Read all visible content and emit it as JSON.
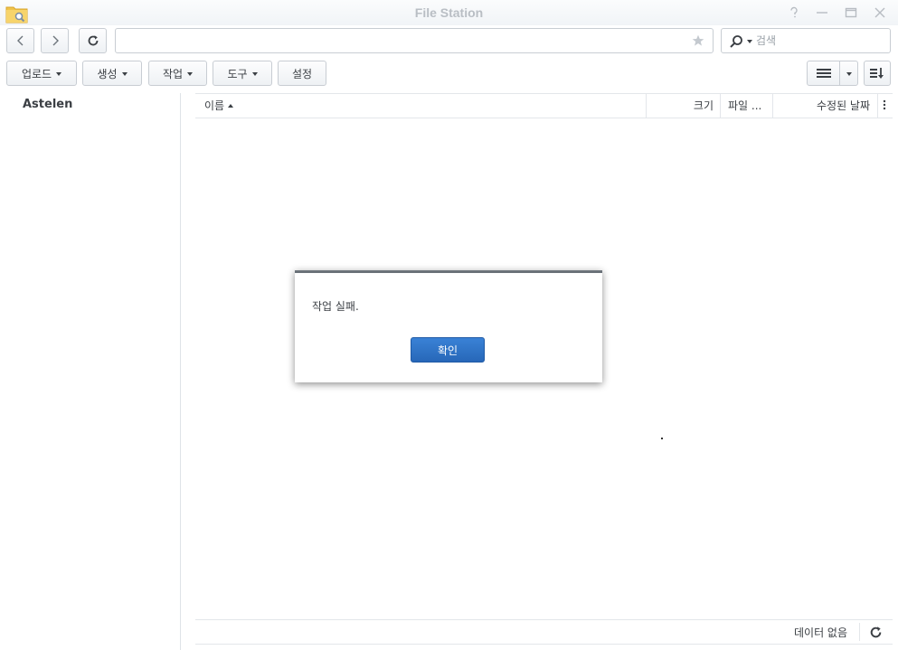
{
  "window": {
    "title": "File Station",
    "icons": [
      "folder-search-icon",
      "help-icon",
      "minimize-icon",
      "maximize-icon",
      "close-icon"
    ]
  },
  "toolbar": {
    "path_value": "",
    "search_placeholder": "검색",
    "menus": [
      "업로드",
      "생성",
      "작업",
      "도구"
    ],
    "settings_label": "설정"
  },
  "sidebar": {
    "root": "Astelen"
  },
  "file_list": {
    "columns": {
      "name": "이름",
      "size": "크기",
      "type": "파일 ...",
      "modified": "수정된 날짜"
    },
    "sort": {
      "column": "name",
      "direction": "ascending"
    },
    "rows": []
  },
  "status": {
    "text": "데이터 없음"
  },
  "dialog": {
    "message": "작업 실패.",
    "ok_label": "확인"
  },
  "colors": {
    "accent": "#2767b8",
    "text": "#3b3f44",
    "border": "#c8cdd3"
  }
}
